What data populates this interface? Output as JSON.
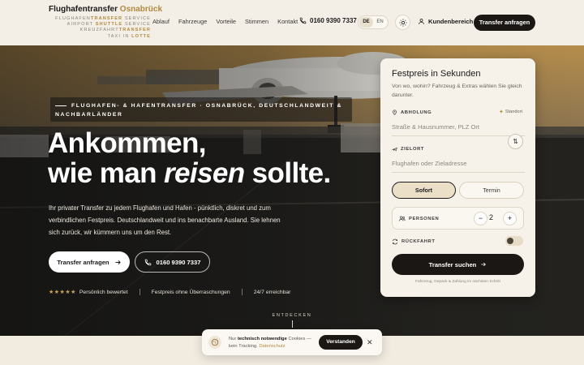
{
  "header": {
    "logo_main": "Flughafentransfer",
    "logo_accent": "Osnabrück",
    "logo_lines": [
      {
        "pre": "FLUGHAFEN",
        "bold": "TRANSFER",
        "post": " SERVICE"
      },
      {
        "pre": "AIRPORT ",
        "bold": "SHUTTLE",
        "post": " SERVICE"
      },
      {
        "pre": "KREUZFAHRT",
        "bold": "TRANSFER",
        "post": ""
      },
      {
        "pre": "TAXI IN ",
        "bold": "LOTTE",
        "post": ""
      }
    ],
    "nav": [
      "Ablauf",
      "Fahrzeuge",
      "Vorteile",
      "Stimmen",
      "Kontakt"
    ],
    "phone": "0160 9390 7337",
    "lang": {
      "de": "DE",
      "en": "EN",
      "active": "DE"
    },
    "account_label": "Kundenbereich",
    "cta": "Transfer anfragen"
  },
  "hero": {
    "tagline": "FLUGHAFEN- & HAFENTRANSFER · OSNABRÜCK, DEUTSCHLANDWEIT & NACHBARLÄNDER",
    "headline_line1": "Ankommen,",
    "headline_pre": "wie man ",
    "headline_em": "reisen",
    "headline_post": " sollte.",
    "text": "Ihr privater Transfer zu jedem Flughafen und Hafen - pünktlich, diskret und zum verbindlichen Festpreis. Deutschlandweit und ins benachbarte Ausland. Sie lehnen sich zurück, wir kümmern uns um den Rest.",
    "primary_btn": "Transfer anfragen",
    "secondary_btn": "0160 9390 7337",
    "trust": [
      "Persönlich bewertet",
      "Festpreis ohne Überraschungen",
      "24/7 erreichbar"
    ],
    "rating_stars": 5,
    "scroll_hint": "ENTDECKEN"
  },
  "booking": {
    "title": "Festpreis in Sekunden",
    "subtitle": "Von wo, wohin? Fahrzeug & Extras wählen Sie gleich darunter.",
    "pickup_label": "ABHOLUNG",
    "location_btn": "Standort",
    "pickup_placeholder": "Straße & Hausnummer, PLZ Ort",
    "dest_label": "ZIELORT",
    "dest_placeholder": "Flughafen oder Zieladresse",
    "mode_now": "Sofort",
    "mode_later": "Termin",
    "pax_label": "PERSONEN",
    "pax_value": "2",
    "return_label": "RÜCKFAHRT",
    "return_enabled": false,
    "submit": "Transfer suchen",
    "footnote": "Fahrzeug, Gepäck & Zahlung im nächsten Schritt"
  },
  "cookie": {
    "pre": "Nur ",
    "bold": "technisch notwendige",
    "mid": " Cookies — kein Tracking. ",
    "link": "Datenschutz",
    "accept": "Verstanden"
  },
  "colors": {
    "accent": "#b08a3e",
    "dark": "#1a1714",
    "background": "#f4efe6"
  }
}
